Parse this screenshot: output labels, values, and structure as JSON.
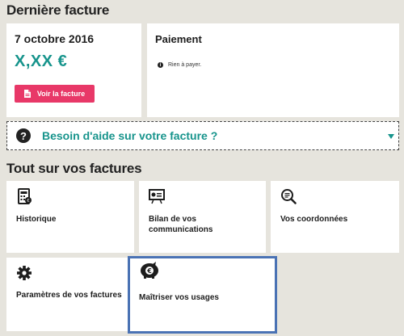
{
  "last_invoice": {
    "title": "Dernière facture",
    "date": "7 octobre 2016",
    "amount": "X,XX €",
    "view_button_label": "Voir la facture"
  },
  "payment": {
    "title": "Paiement",
    "info_glyph": "i",
    "status": "Rien à payer."
  },
  "help": {
    "glyph": "?",
    "label": "Besoin d'aide sur votre facture ?"
  },
  "all_invoices": {
    "title": "Tout sur vos factures",
    "tiles": [
      {
        "label": "Historique",
        "icon": "calculator-icon"
      },
      {
        "label": "Bilan de vos communications",
        "icon": "presentation-icon"
      },
      {
        "label": "Vos coordonnées",
        "icon": "magnifier-icon"
      },
      {
        "label": "Paramètres de vos factures",
        "icon": "gear-icon"
      },
      {
        "label": "Maîtriser vos usages",
        "icon": "piggy-bank-icon"
      }
    ]
  },
  "colors": {
    "accent_teal": "#17948c",
    "button_pink": "#e83868",
    "selection_blue": "#4a72b4",
    "background": "#e6e4dd"
  }
}
